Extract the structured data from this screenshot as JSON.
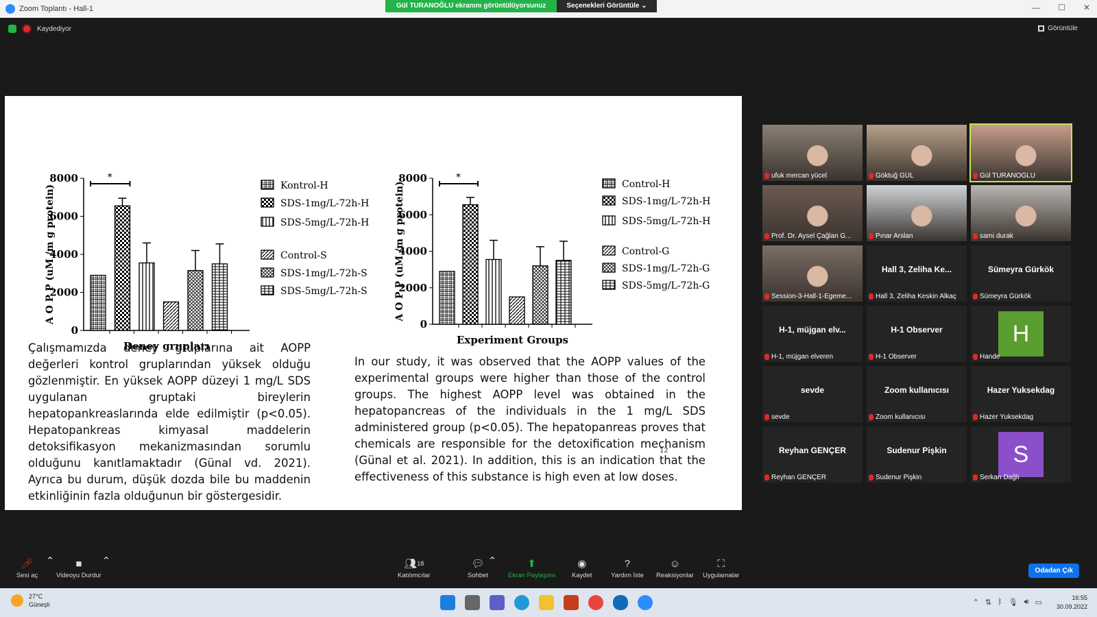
{
  "window": {
    "title": "Zoom Toplantı - Hall-1",
    "share_banner": "Gül TURANOĞLU ekranını görüntülüyorsunuz",
    "view_options": "Seçenekleri Görüntüle",
    "controls": [
      "—",
      "☐",
      "✕"
    ]
  },
  "status": {
    "recording": "Kaydediyor",
    "view": "Görüntüle"
  },
  "slide": {
    "left_text": "Çalışmamızda deney gruplarına ait AOPP değerleri kontrol gruplarından yüksek olduğu gözlenmiştir. En yüksek AOPP düzeyi 1 mg/L SDS uygulanan gruptaki bireylerin hepatopankreaslarında elde edilmiştir (p<0.05). Hepatopankreas kimyasal maddelerin detoksifikasyon mekanizmasından sorumlu olduğunu kanıtlamaktadır (Günal vd. 2021). Ayrıca bu durum, düşük dozda bile bu maddenin etkinliğinin fazla olduğunun bir göstergesidir.",
    "right_text": "In our study, it was observed that the AOPP values of the experimental groups were higher than those of the control groups. The highest AOPP level was obtained in the hepatopancreas of the individuals in the 1 mg/L SDS administered group (p<0.05). The hepatopanreas proves that chemicals are responsible for the detoxification mechanism (Günal et al. 2021). In addition, this is an indication that the effectiveness of this substance is high even at low doses.",
    "page_number": "12"
  },
  "chart_data": [
    {
      "type": "bar",
      "xlabel": "Deney grupları",
      "ylabel": "A O P P (uM /m g protein)",
      "ylim": [
        0,
        8000
      ],
      "yticks": [
        "0",
        "2000",
        "4000",
        "6000",
        "8000"
      ],
      "categories": [
        "Kontrol-H",
        "SDS-1mg/L-72h-H",
        "SDS-5mg/L-72h-H",
        "Control-S",
        "SDS-1mg/L-72h-S",
        "SDS-5mg/L-72h-S"
      ],
      "values": [
        2900,
        6550,
        3550,
        1500,
        3150,
        3500
      ],
      "errors": [
        0,
        400,
        1050,
        0,
        1050,
        1050
      ],
      "legend": [
        "Kontrol-H",
        "SDS-1mg/L-72h-H",
        "SDS-5mg/L-72h-H",
        "Control-S",
        "SDS-1mg/L-72h-S",
        "SDS-5mg/L-72h-S"
      ],
      "annotation": "*"
    },
    {
      "type": "bar",
      "xlabel": "Experiment Groups",
      "ylabel": "A O P P (uM /m g protein)",
      "ylim": [
        0,
        8000
      ],
      "yticks": [
        "0",
        "2000",
        "4000",
        "6000",
        "8000"
      ],
      "categories": [
        "Control-H",
        "SDS-1mg/L-72h-H",
        "SDS-5mg/L-72h-H",
        "Control-G",
        "SDS-1mg/L-72h-G",
        "SDS-5mg/L-72h-G"
      ],
      "values": [
        2900,
        6550,
        3550,
        1500,
        3200,
        3500
      ],
      "errors": [
        0,
        400,
        1050,
        0,
        1050,
        1050
      ],
      "legend": [
        "Control-H",
        "SDS-1mg/L-72h-H",
        "SDS-5mg/L-72h-H",
        "Control-G",
        "SDS-1mg/L-72h-G",
        "SDS-5mg/L-72h-G"
      ],
      "annotation": "*"
    }
  ],
  "participants": [
    {
      "label": "ufuk mercan yücel",
      "video": true,
      "bg": "#8a7f73"
    },
    {
      "label": "Göktuğ GÜL",
      "video": true,
      "bg": "#b7a08a"
    },
    {
      "label": "Gül TURANOĞLU",
      "video": true,
      "bg": "#c79e8d",
      "active": true
    },
    {
      "label": "Prof. Dr. Aysel Çağlan G...",
      "video": true,
      "bg": "#6c5a52"
    },
    {
      "label": "Pınar Arslan",
      "video": true,
      "bg": "#cfd3d7"
    },
    {
      "label": "sami durak",
      "video": true,
      "bg": "#b9b5b0"
    },
    {
      "label": "Session-3-Hall-1-Egeme...",
      "video": true,
      "bg": "#7b6e63"
    },
    {
      "name": "Hall 3, Zeliha Ke...",
      "label": "Hall 3, Zeliha Keskin Alkaç"
    },
    {
      "name": "Sümeyra Gürkök",
      "label": "Sümeyra Gürkök"
    },
    {
      "name": "H-1, müjgan elv...",
      "label": "H-1, müjgan elveren"
    },
    {
      "name": "H-1 Observer",
      "label": "H-1 Observer"
    },
    {
      "avatar": "H",
      "avatar_color": "#5a9e2f",
      "label": "Hande"
    },
    {
      "name": "sevde",
      "label": "sevde"
    },
    {
      "name": "Zoom kullanıcısı",
      "label": "Zoom kullanıcısı"
    },
    {
      "name": "Hazer Yuksekdag",
      "label": "Hazer Yuksekdag"
    },
    {
      "name": "Reyhan GENÇER",
      "label": "Reyhan GENÇER"
    },
    {
      "name": "Sudenur Pişkin",
      "label": "Sudenur Pişkin"
    },
    {
      "avatar": "S",
      "avatar_color": "#8a4fc9",
      "label": "Serkan Dağlı"
    }
  ],
  "toolbar": {
    "mute": "Sesi aç",
    "video": "Videoyu Durdur",
    "participants": "Katılımcılar",
    "participants_count": "18",
    "chat": "Sohbet",
    "share": "Ekran Paylaşımı",
    "record": "Kaydet",
    "help": "Yardım İste",
    "reactions": "Reaksiyonlar",
    "apps": "Uygulamalar",
    "leave": "Odadan Çık"
  },
  "taskbar": {
    "temp": "27°C",
    "weather": "Güneşli",
    "time": "16:55",
    "date": "30.09.2022"
  }
}
